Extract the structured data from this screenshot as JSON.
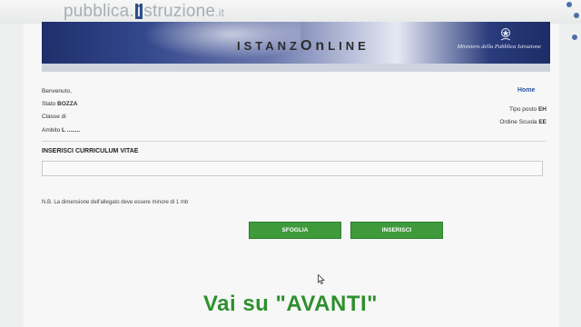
{
  "brand": {
    "part1": "pubblica.",
    "i_letter": "i",
    "part2": "struzione",
    "tld": ".it"
  },
  "banner": {
    "title_prefix": "ISTANZ",
    "title_on": "On",
    "title_line": "LINE",
    "ministry": "Ministero della Pubblica Istruzione"
  },
  "nav": {
    "home_label": "Home"
  },
  "user_info": {
    "welcome_label": "Benvenuto,",
    "stato_label": "Stato",
    "stato_value": "BOZZA",
    "classe_label": "Classe di",
    "ambito_label": "Ambito",
    "ambito_value": "L ........",
    "tipo_posto_label": "Tipo posto",
    "tipo_posto_value": "EH",
    "ordine_scuola_label": "Ordine Scuola",
    "ordine_scuola_value": "EE"
  },
  "form": {
    "section_title": "INSERISCI CURRICULUM VITAE",
    "file_value": "",
    "note": "N.B. La dimensione dell'allegato deve essere minore di 1 mb",
    "browse_label": "SFOGLIA",
    "insert_label": "INSERISCI"
  },
  "caption": "Vai su \"AVANTI\"",
  "colors": {
    "banner_blue": "#2a3c7c",
    "button_green": "#3f9a3c",
    "caption_green": "#2f8f2f"
  }
}
